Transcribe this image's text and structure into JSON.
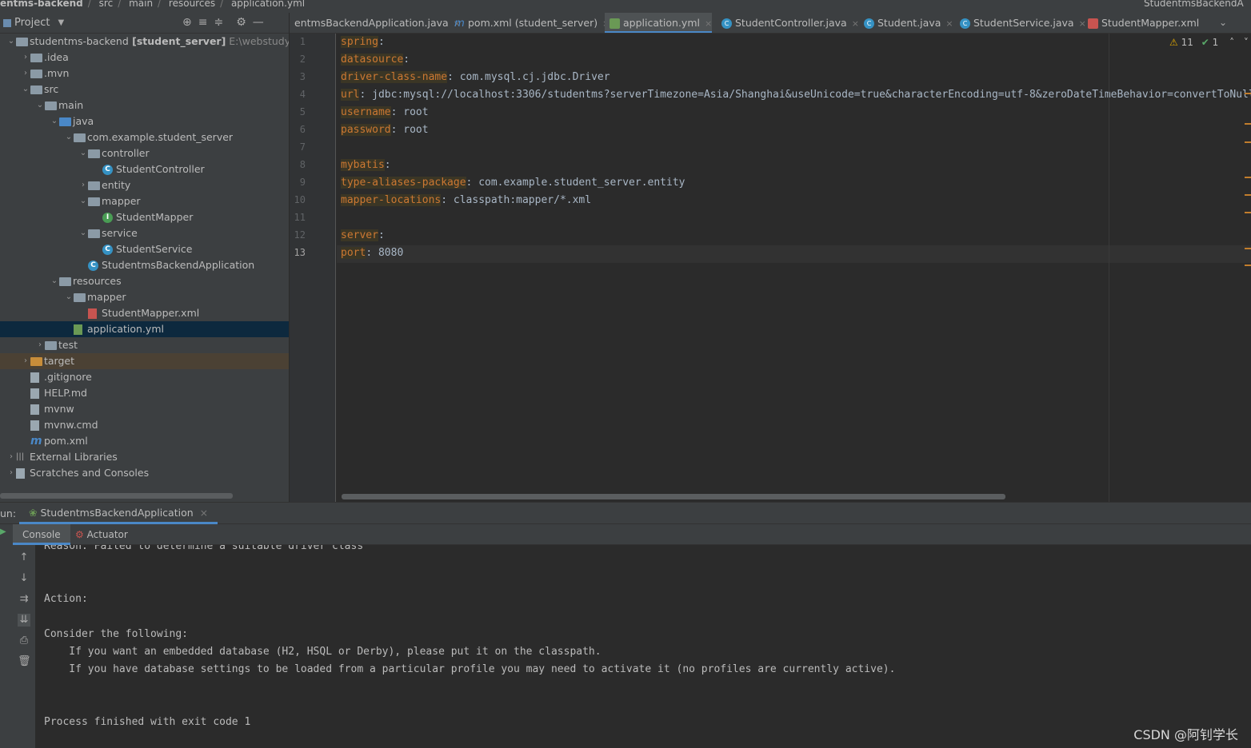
{
  "breadcrumb": {
    "project": "entms-backend",
    "items": [
      "src",
      "main",
      "resources",
      "application.yml"
    ],
    "right_run_config": "StudentmsBackendA"
  },
  "project_panel": {
    "title": "Project",
    "tree": [
      {
        "label": "studentms-backend",
        "bold": "[student_server]",
        "path": "E:\\webstudy\\stude",
        "depth": 0,
        "arrow": "down",
        "icon": "module-folder-icon"
      },
      {
        "label": ".idea",
        "depth": 1,
        "arrow": "right",
        "icon": "folder-icon"
      },
      {
        "label": ".mvn",
        "depth": 1,
        "arrow": "right",
        "icon": "folder-icon"
      },
      {
        "label": "src",
        "depth": 1,
        "arrow": "down",
        "icon": "folder-icon"
      },
      {
        "label": "main",
        "depth": 2,
        "arrow": "down",
        "icon": "folder-icon"
      },
      {
        "label": "java",
        "depth": 3,
        "arrow": "down",
        "icon": "source-folder-icon"
      },
      {
        "label": "com.example.student_server",
        "depth": 4,
        "arrow": "down",
        "icon": "package-icon"
      },
      {
        "label": "controller",
        "depth": 5,
        "arrow": "down",
        "icon": "package-icon"
      },
      {
        "label": "StudentController",
        "depth": 6,
        "arrow": "",
        "icon": "class-icon"
      },
      {
        "label": "entity",
        "depth": 5,
        "arrow": "right",
        "icon": "package-icon"
      },
      {
        "label": "mapper",
        "depth": 5,
        "arrow": "down",
        "icon": "package-icon"
      },
      {
        "label": "StudentMapper",
        "depth": 6,
        "arrow": "",
        "icon": "interface-icon"
      },
      {
        "label": "service",
        "depth": 5,
        "arrow": "down",
        "icon": "package-icon"
      },
      {
        "label": "StudentService",
        "depth": 6,
        "arrow": "",
        "icon": "class-icon"
      },
      {
        "label": "StudentmsBackendApplication",
        "depth": 5,
        "arrow": "",
        "icon": "spring-class-icon"
      },
      {
        "label": "resources",
        "depth": 3,
        "arrow": "down",
        "icon": "resources-folder-icon"
      },
      {
        "label": "mapper",
        "depth": 4,
        "arrow": "down",
        "icon": "folder-icon"
      },
      {
        "label": "StudentMapper.xml",
        "depth": 5,
        "arrow": "",
        "icon": "xml-file-icon"
      },
      {
        "label": "application.yml",
        "depth": 4,
        "arrow": "",
        "icon": "yaml-file-icon",
        "selected": true
      },
      {
        "label": "test",
        "depth": 2,
        "arrow": "right",
        "icon": "folder-icon"
      },
      {
        "label": "target",
        "depth": 1,
        "arrow": "right",
        "icon": "excluded-folder-icon",
        "highlight": true
      },
      {
        "label": ".gitignore",
        "depth": 1,
        "arrow": "",
        "icon": "file-icon"
      },
      {
        "label": "HELP.md",
        "depth": 1,
        "arrow": "",
        "icon": "markdown-file-icon"
      },
      {
        "label": "mvnw",
        "depth": 1,
        "arrow": "",
        "icon": "script-file-icon"
      },
      {
        "label": "mvnw.cmd",
        "depth": 1,
        "arrow": "",
        "icon": "file-icon"
      },
      {
        "label": "pom.xml",
        "depth": 1,
        "arrow": "",
        "icon": "maven-icon"
      },
      {
        "label": "External Libraries",
        "depth": 0,
        "arrow": "right",
        "icon": "libraries-icon"
      },
      {
        "label": "Scratches and Consoles",
        "depth": 0,
        "arrow": "right",
        "icon": "scratches-icon"
      }
    ]
  },
  "editor_tabs": [
    {
      "label": "entmsBackendApplication.java",
      "icon": "spring-class-icon"
    },
    {
      "label": "pom.xml (student_server)",
      "icon": "maven-icon"
    },
    {
      "label": "application.yml",
      "icon": "yaml-file-icon",
      "active": true
    },
    {
      "label": "StudentController.java",
      "icon": "class-icon"
    },
    {
      "label": "Student.java",
      "icon": "class-icon"
    },
    {
      "label": "StudentService.java",
      "icon": "class-icon"
    },
    {
      "label": "StudentMapper.xml",
      "icon": "xml-file-icon"
    }
  ],
  "editor": {
    "lines": [
      {
        "n": "1",
        "key": "spring",
        "val": ""
      },
      {
        "n": "2",
        "key": "datasource",
        "val": ""
      },
      {
        "n": "3",
        "key": "driver-class-name",
        "val": " com.mysql.cj.jdbc.Driver"
      },
      {
        "n": "4",
        "key": "url",
        "val": " jdbc:mysql://localhost:3306/studentms?serverTimezone=Asia/Shanghai&useUnicode=true&characterEncoding=utf-8&zeroDateTimeBehavior=convertToNull"
      },
      {
        "n": "5",
        "key": "username",
        "val": " root"
      },
      {
        "n": "6",
        "key": "password",
        "val": " root"
      },
      {
        "n": "7",
        "key": "",
        "val": ""
      },
      {
        "n": "8",
        "key": "mybatis",
        "val": ""
      },
      {
        "n": "9",
        "key": "type-aliases-package",
        "val": " com.example.student_server.entity"
      },
      {
        "n": "10",
        "key": "mapper-locations",
        "val": " classpath:mapper/*.xml"
      },
      {
        "n": "11",
        "key": "",
        "val": ""
      },
      {
        "n": "12",
        "key": "server",
        "val": ""
      },
      {
        "n": "13",
        "key": "port",
        "val": " 8080"
      }
    ],
    "inspections": {
      "warnings": "11",
      "ok": "1"
    }
  },
  "run_panel": {
    "label": "un:",
    "config": "StudentmsBackendApplication",
    "subtabs": [
      "Console",
      "Actuator"
    ],
    "console_lines": [
      "Reason: Failed to determine a suitable driver class",
      "",
      "",
      "Action:",
      "",
      "Consider the following:",
      "    If you want an embedded database (H2, HSQL or Derby), please put it on the classpath.",
      "    If you have database settings to be loaded from a particular profile you may need to activate it (no profiles are currently active).",
      "",
      "",
      "Process finished with exit code 1"
    ]
  },
  "watermark": "CSDN @阿钊学长"
}
